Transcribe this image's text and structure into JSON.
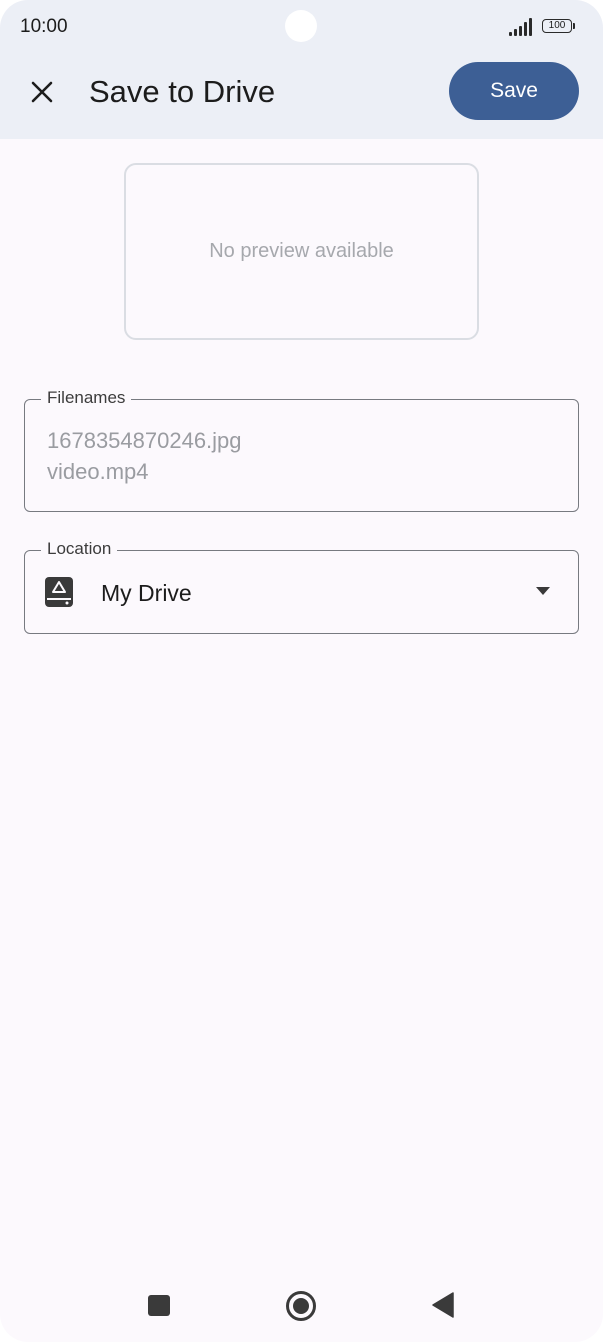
{
  "status_bar": {
    "time": "10:00",
    "battery": "100"
  },
  "app_bar": {
    "title": "Save to Drive",
    "save_label": "Save",
    "close_icon": "close-icon"
  },
  "preview": {
    "message": "No preview available"
  },
  "filenames_field": {
    "label": "Filenames",
    "files": [
      "1678354870246.jpg",
      "video.mp4"
    ]
  },
  "location_field": {
    "label": "Location",
    "value": "My Drive",
    "icon": "my-drive-icon"
  },
  "nav_bar": {
    "recents_icon": "recents-square-icon",
    "home_icon": "home-circle-icon",
    "back_icon": "back-triangle-icon"
  },
  "colors": {
    "accent": "#3d5f95",
    "header_bg": "#eceff6",
    "page_bg": "#fcf9fd"
  }
}
